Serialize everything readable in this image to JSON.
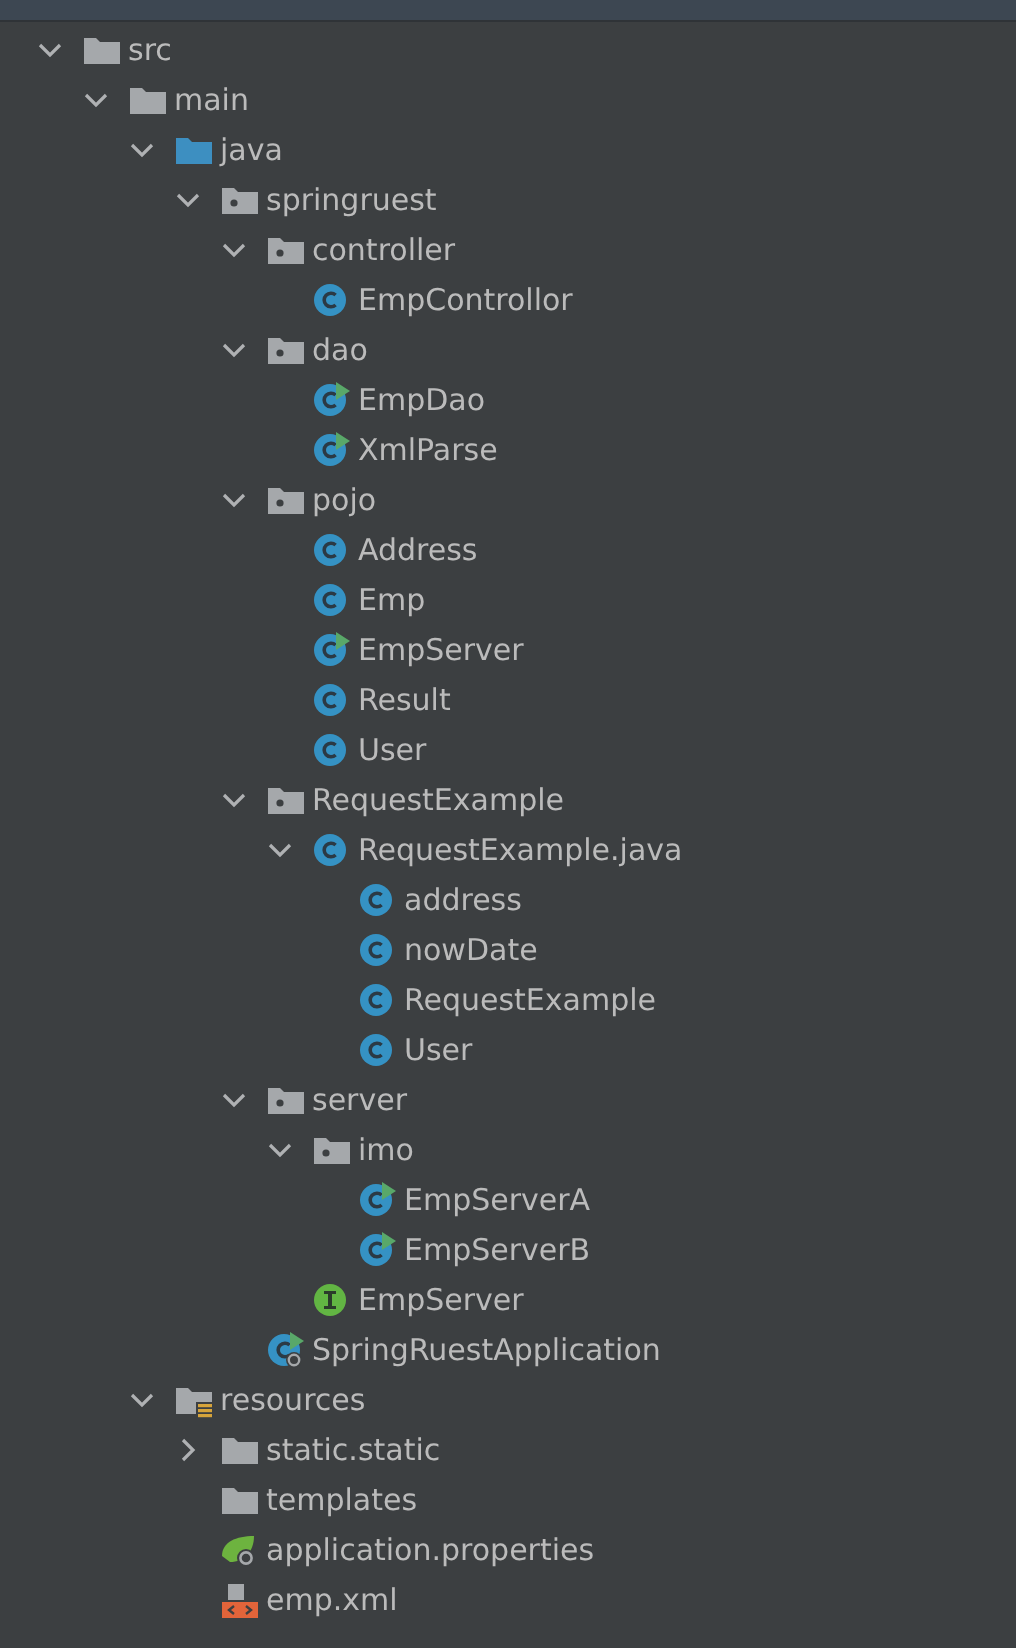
{
  "tree": [
    {
      "name": "src",
      "kind": "folder",
      "expanded": true,
      "children": [
        {
          "name": "main",
          "kind": "folder",
          "expanded": true,
          "children": [
            {
              "name": "java",
              "kind": "source-folder",
              "expanded": true,
              "children": [
                {
                  "name": "springruest",
                  "kind": "package",
                  "expanded": true,
                  "children": [
                    {
                      "name": "controller",
                      "kind": "package",
                      "expanded": true,
                      "children": [
                        {
                          "name": "EmpControllor",
                          "kind": "class"
                        }
                      ]
                    },
                    {
                      "name": "dao",
                      "kind": "package",
                      "expanded": true,
                      "children": [
                        {
                          "name": "EmpDao",
                          "kind": "runnable-class"
                        },
                        {
                          "name": "XmlParse",
                          "kind": "runnable-class"
                        }
                      ]
                    },
                    {
                      "name": "pojo",
                      "kind": "package",
                      "expanded": true,
                      "children": [
                        {
                          "name": "Address",
                          "kind": "class"
                        },
                        {
                          "name": "Emp",
                          "kind": "class"
                        },
                        {
                          "name": "EmpServer",
                          "kind": "runnable-class"
                        },
                        {
                          "name": "Result",
                          "kind": "class"
                        },
                        {
                          "name": "User",
                          "kind": "class"
                        }
                      ]
                    },
                    {
                      "name": "RequestExample",
                      "kind": "package",
                      "expanded": true,
                      "children": [
                        {
                          "name": "RequestExample.java",
                          "kind": "class",
                          "expanded": true,
                          "children": [
                            {
                              "name": "address",
                              "kind": "class"
                            },
                            {
                              "name": "nowDate",
                              "kind": "class"
                            },
                            {
                              "name": "RequestExample",
                              "kind": "class"
                            },
                            {
                              "name": "User",
                              "kind": "class"
                            }
                          ]
                        }
                      ]
                    },
                    {
                      "name": "server",
                      "kind": "package",
                      "expanded": true,
                      "children": [
                        {
                          "name": "imo",
                          "kind": "package",
                          "expanded": true,
                          "children": [
                            {
                              "name": "EmpServerA",
                              "kind": "runnable-class"
                            },
                            {
                              "name": "EmpServerB",
                              "kind": "runnable-class"
                            }
                          ]
                        },
                        {
                          "name": "EmpServer",
                          "kind": "interface"
                        }
                      ]
                    },
                    {
                      "name": "SpringRuestApplication",
                      "kind": "boot-class"
                    }
                  ]
                }
              ]
            },
            {
              "name": "resources",
              "kind": "resources-folder",
              "expanded": true,
              "children": [
                {
                  "name": "static.static",
                  "kind": "folder",
                  "expanded": false
                },
                {
                  "name": "templates",
                  "kind": "folder"
                },
                {
                  "name": "application.properties",
                  "kind": "properties"
                },
                {
                  "name": "emp.xml",
                  "kind": "xml"
                }
              ]
            }
          ]
        }
      ]
    }
  ]
}
